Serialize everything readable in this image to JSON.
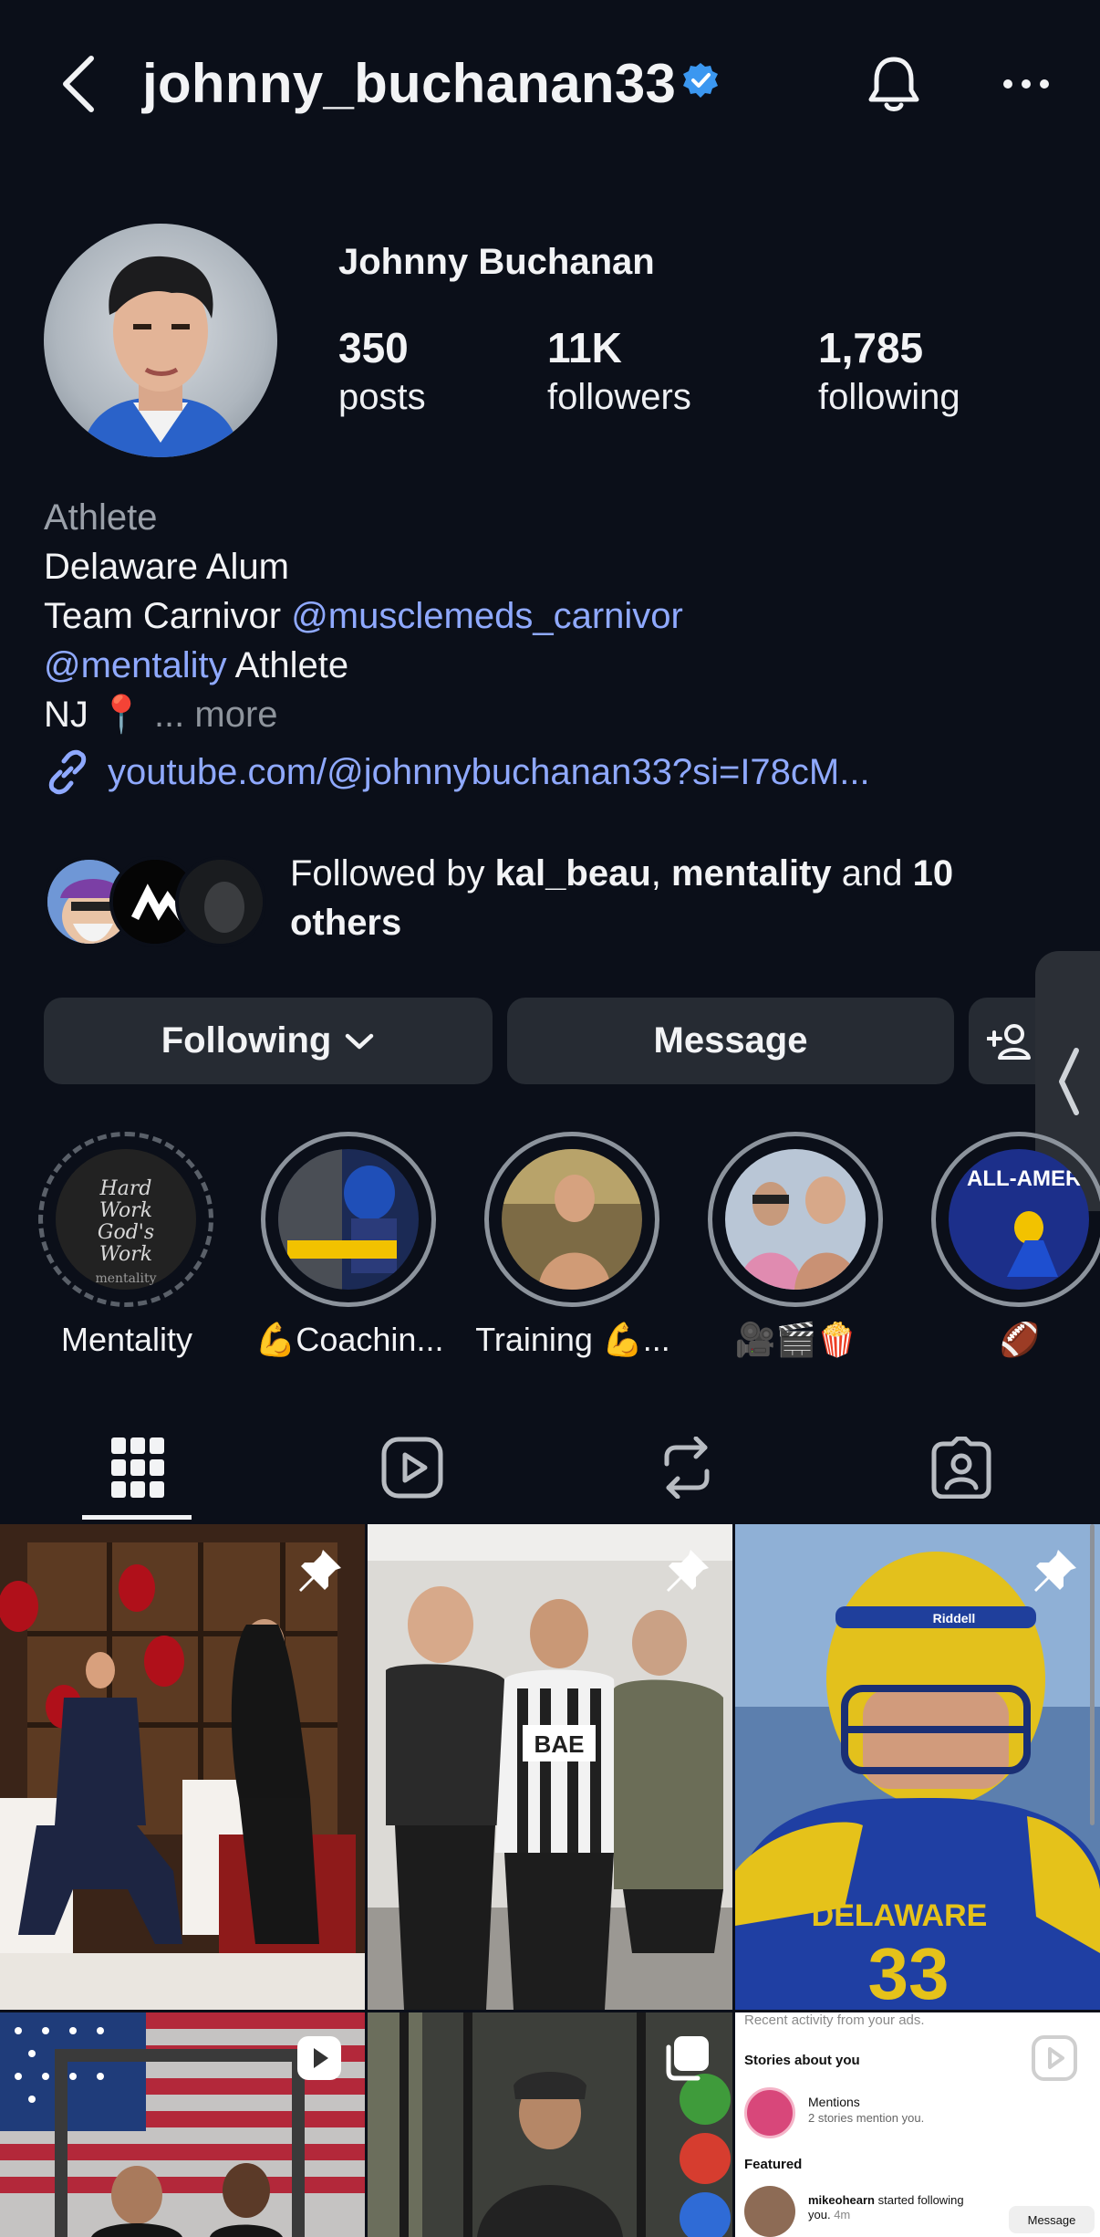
{
  "header": {
    "handle": "johnny_buchanan33",
    "verified": true,
    "icons": [
      "back-chevron-icon",
      "verified-badge-icon",
      "bell-icon",
      "more-dots-icon"
    ]
  },
  "profile": {
    "display_name": "Johnny Buchanan",
    "stats": [
      {
        "value": "350",
        "label": "posts"
      },
      {
        "value": "11K",
        "label": "followers"
      },
      {
        "value": "1,785",
        "label": "following"
      }
    ],
    "category": "Athlete",
    "bio_line1": "Delaware Alum",
    "bio_line2_prefix": "Team Carnivor",
    "bio_line2_mention": "@musclemeds_carnivor",
    "bio_line3_mention": "@mentality",
    "bio_line3_suffix": "Athlete",
    "bio_line4": "NJ 📍",
    "bio_ellipsis": "...",
    "bio_more": "more",
    "link": "youtube.com/@johnnybuchanan33?si=I78cM..."
  },
  "followed_by": {
    "prefix": "Followed by",
    "user1": "kal_beau",
    "separator": ",",
    "user2": "mentality",
    "and": "and",
    "others": "10 others"
  },
  "actions": {
    "following_label": "Following",
    "message_label": "Message"
  },
  "highlights": [
    {
      "label": "Mentality"
    },
    {
      "label": "💪Coachin..."
    },
    {
      "label": "Training 💪..."
    },
    {
      "label": "🎥🎬🍿"
    },
    {
      "label": "🏈"
    }
  ],
  "highlight_texts": {
    "h1_line1": "Hard",
    "h1_line2": "Work",
    "h1_line3": "God's",
    "h1_line4": "Work",
    "h1_line5": "mentality",
    "h5_text": "ALL-AMER"
  },
  "tabs": [
    "grid-icon",
    "reels-icon",
    "reposts-icon",
    "tagged-icon"
  ],
  "grid_posts": {
    "post3_jersey": "DELAWARE",
    "post3_number": "33",
    "post3_helmet": "Riddell",
    "post2_shirt": "BAE",
    "notif_header": "Recent activity from your ads.",
    "notif_stories": "Stories about you",
    "notif_mentions": "Mentions",
    "notif_mentions_sub": "2 stories mention you.",
    "notif_featured": "Featured",
    "notif_user": "mikeohearn",
    "notif_action": "started following you.",
    "notif_time": "4m",
    "notif_btn": "Message"
  },
  "colors": {
    "background": "#0b0f19",
    "link": "#8fa9ff",
    "button": "#262b33",
    "verified": "#3b97f0"
  }
}
